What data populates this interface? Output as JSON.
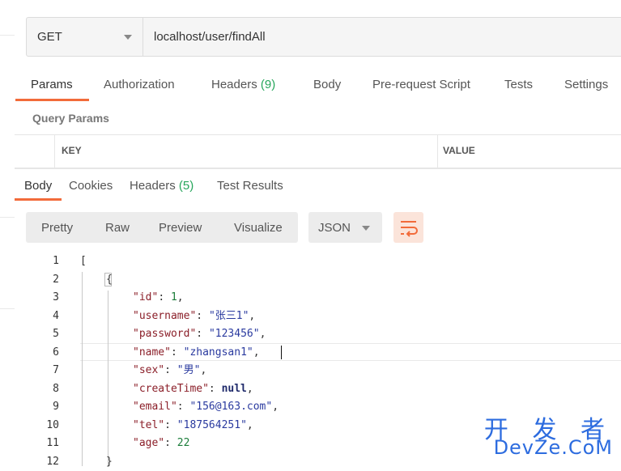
{
  "request": {
    "method": "GET",
    "url": "localhost/user/findAll"
  },
  "request_tabs": [
    {
      "label": "Params",
      "count": ""
    },
    {
      "label": "Authorization",
      "count": ""
    },
    {
      "label": "Headers",
      "count": "(9)"
    },
    {
      "label": "Body",
      "count": ""
    },
    {
      "label": "Pre-request Script",
      "count": ""
    },
    {
      "label": "Tests",
      "count": ""
    },
    {
      "label": "Settings",
      "count": ""
    }
  ],
  "query_params": {
    "label": "Query Params",
    "columns": [
      "KEY",
      "VALUE"
    ]
  },
  "response_tabs": [
    {
      "label": "Body",
      "count": ""
    },
    {
      "label": "Cookies",
      "count": ""
    },
    {
      "label": "Headers",
      "count": "(5)"
    },
    {
      "label": "Test Results",
      "count": ""
    }
  ],
  "view_modes": [
    "Pretty",
    "Raw",
    "Preview",
    "Visualize"
  ],
  "format": "JSON",
  "wrap_icon": "wrap-lines-icon",
  "accent_color": "#f26b3a",
  "code": {
    "line_numbers": [
      "1",
      "2",
      "3",
      "4",
      "5",
      "6",
      "7",
      "8",
      "9",
      "10",
      "11",
      "12"
    ],
    "open_array": "[",
    "open_object": "{",
    "fields": [
      {
        "key": "\"id\"",
        "value": "1",
        "type": "number",
        "comma": true
      },
      {
        "key": "\"username\"",
        "value": "\"张三1\"",
        "type": "string",
        "comma": true
      },
      {
        "key": "\"password\"",
        "value": "\"123456\"",
        "type": "string",
        "comma": true
      },
      {
        "key": "\"name\"",
        "value": "\"zhangsan1\"",
        "type": "string",
        "comma": true
      },
      {
        "key": "\"sex\"",
        "value": "\"男\"",
        "type": "string",
        "comma": true
      },
      {
        "key": "\"createTime\"",
        "value": "null",
        "type": "null",
        "comma": true
      },
      {
        "key": "\"email\"",
        "value": "\"156@163.com\"",
        "type": "string",
        "comma": true
      },
      {
        "key": "\"tel\"",
        "value": "\"187564251\"",
        "type": "string",
        "comma": true
      },
      {
        "key": "\"age\"",
        "value": "22",
        "type": "number",
        "comma": false
      }
    ],
    "close_object": "}"
  },
  "watermark": {
    "main": "开 发 者",
    "sub": "DevZe.CoM"
  }
}
